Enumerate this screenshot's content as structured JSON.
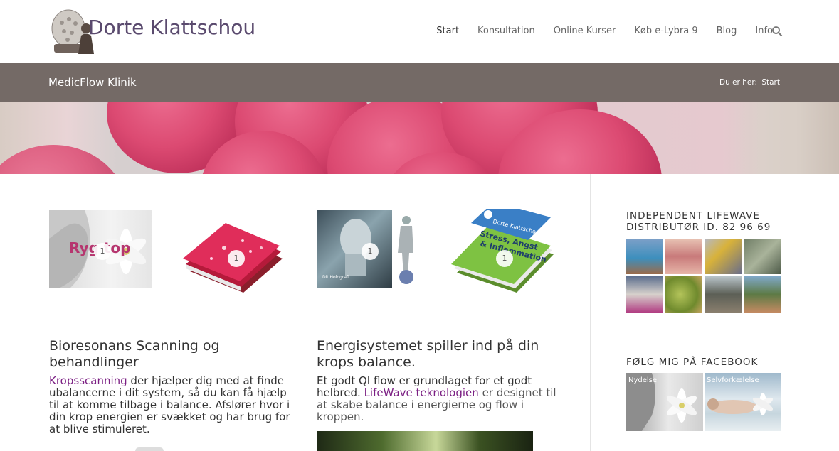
{
  "header": {
    "logo_text": "Dorte Klattschou",
    "nav": [
      "Start",
      "Konsultation",
      "Online Kurser",
      "Køb e-Lybra 9",
      "Blog",
      "Info"
    ],
    "active_nav": "Start"
  },
  "titlebar": {
    "title": "MedicFlow Klinik",
    "breadcrumb_label": "Du er her:",
    "breadcrumb_current": "Start"
  },
  "thumbs": [
    {
      "counter": "1",
      "text": "Ryg top"
    },
    {
      "counter": "1"
    },
    {
      "counter": "1",
      "text": "Dit Holografi"
    },
    {
      "counter": "1",
      "text": "Dorte Klattschou · Stress, Angst & Inflammation"
    }
  ],
  "posts": [
    {
      "title": "Bioresonans Scanning og behandlinger",
      "link": "Kropsscanning",
      "text": " der hjælper dig med at finde ubalancerne i dit system, så du kan få hjælp til at komme tilbage i balance. Afslører hvor i din krop energien er svækket og har brug for at blive stimuleret."
    },
    {
      "title": "Energisystemet spiller ind på din krops balance.",
      "text_before": "Et godt QI flow er grundlaget for et godt helbred. ",
      "link": "LifeWave teknologien",
      "text_after": " er designet til at skabe balance i energierne og flow i kroppen."
    }
  ],
  "sidebar": {
    "widget1_title": "INDEPENDENT LIFEWAVE DISTRIBUTØR ID. 82 96 69",
    "widget2_title": "FØLG MIG PÅ FACEBOOK",
    "fb_tiles": [
      "Nydelse",
      "Selvforkælelse"
    ]
  },
  "colors": {
    "titlebar": "#746a66",
    "link": "#7b1f83",
    "logo": "#5a4a6e"
  }
}
